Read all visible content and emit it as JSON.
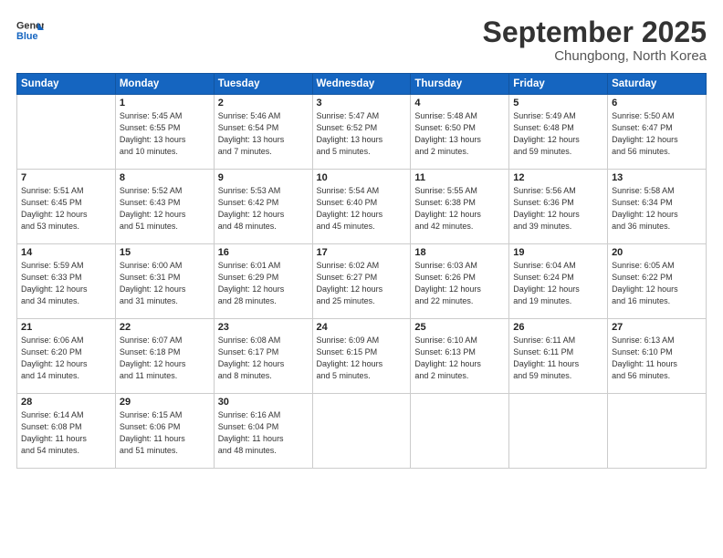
{
  "logo": {
    "line1": "General",
    "line2": "Blue"
  },
  "header": {
    "month": "September 2025",
    "location": "Chungbong, North Korea"
  },
  "weekdays": [
    "Sunday",
    "Monday",
    "Tuesday",
    "Wednesday",
    "Thursday",
    "Friday",
    "Saturday"
  ],
  "weeks": [
    [
      {
        "day": "",
        "info": ""
      },
      {
        "day": "1",
        "info": "Sunrise: 5:45 AM\nSunset: 6:55 PM\nDaylight: 13 hours\nand 10 minutes."
      },
      {
        "day": "2",
        "info": "Sunrise: 5:46 AM\nSunset: 6:54 PM\nDaylight: 13 hours\nand 7 minutes."
      },
      {
        "day": "3",
        "info": "Sunrise: 5:47 AM\nSunset: 6:52 PM\nDaylight: 13 hours\nand 5 minutes."
      },
      {
        "day": "4",
        "info": "Sunrise: 5:48 AM\nSunset: 6:50 PM\nDaylight: 13 hours\nand 2 minutes."
      },
      {
        "day": "5",
        "info": "Sunrise: 5:49 AM\nSunset: 6:48 PM\nDaylight: 12 hours\nand 59 minutes."
      },
      {
        "day": "6",
        "info": "Sunrise: 5:50 AM\nSunset: 6:47 PM\nDaylight: 12 hours\nand 56 minutes."
      }
    ],
    [
      {
        "day": "7",
        "info": "Sunrise: 5:51 AM\nSunset: 6:45 PM\nDaylight: 12 hours\nand 53 minutes."
      },
      {
        "day": "8",
        "info": "Sunrise: 5:52 AM\nSunset: 6:43 PM\nDaylight: 12 hours\nand 51 minutes."
      },
      {
        "day": "9",
        "info": "Sunrise: 5:53 AM\nSunset: 6:42 PM\nDaylight: 12 hours\nand 48 minutes."
      },
      {
        "day": "10",
        "info": "Sunrise: 5:54 AM\nSunset: 6:40 PM\nDaylight: 12 hours\nand 45 minutes."
      },
      {
        "day": "11",
        "info": "Sunrise: 5:55 AM\nSunset: 6:38 PM\nDaylight: 12 hours\nand 42 minutes."
      },
      {
        "day": "12",
        "info": "Sunrise: 5:56 AM\nSunset: 6:36 PM\nDaylight: 12 hours\nand 39 minutes."
      },
      {
        "day": "13",
        "info": "Sunrise: 5:58 AM\nSunset: 6:34 PM\nDaylight: 12 hours\nand 36 minutes."
      }
    ],
    [
      {
        "day": "14",
        "info": "Sunrise: 5:59 AM\nSunset: 6:33 PM\nDaylight: 12 hours\nand 34 minutes."
      },
      {
        "day": "15",
        "info": "Sunrise: 6:00 AM\nSunset: 6:31 PM\nDaylight: 12 hours\nand 31 minutes."
      },
      {
        "day": "16",
        "info": "Sunrise: 6:01 AM\nSunset: 6:29 PM\nDaylight: 12 hours\nand 28 minutes."
      },
      {
        "day": "17",
        "info": "Sunrise: 6:02 AM\nSunset: 6:27 PM\nDaylight: 12 hours\nand 25 minutes."
      },
      {
        "day": "18",
        "info": "Sunrise: 6:03 AM\nSunset: 6:26 PM\nDaylight: 12 hours\nand 22 minutes."
      },
      {
        "day": "19",
        "info": "Sunrise: 6:04 AM\nSunset: 6:24 PM\nDaylight: 12 hours\nand 19 minutes."
      },
      {
        "day": "20",
        "info": "Sunrise: 6:05 AM\nSunset: 6:22 PM\nDaylight: 12 hours\nand 16 minutes."
      }
    ],
    [
      {
        "day": "21",
        "info": "Sunrise: 6:06 AM\nSunset: 6:20 PM\nDaylight: 12 hours\nand 14 minutes."
      },
      {
        "day": "22",
        "info": "Sunrise: 6:07 AM\nSunset: 6:18 PM\nDaylight: 12 hours\nand 11 minutes."
      },
      {
        "day": "23",
        "info": "Sunrise: 6:08 AM\nSunset: 6:17 PM\nDaylight: 12 hours\nand 8 minutes."
      },
      {
        "day": "24",
        "info": "Sunrise: 6:09 AM\nSunset: 6:15 PM\nDaylight: 12 hours\nand 5 minutes."
      },
      {
        "day": "25",
        "info": "Sunrise: 6:10 AM\nSunset: 6:13 PM\nDaylight: 12 hours\nand 2 minutes."
      },
      {
        "day": "26",
        "info": "Sunrise: 6:11 AM\nSunset: 6:11 PM\nDaylight: 11 hours\nand 59 minutes."
      },
      {
        "day": "27",
        "info": "Sunrise: 6:13 AM\nSunset: 6:10 PM\nDaylight: 11 hours\nand 56 minutes."
      }
    ],
    [
      {
        "day": "28",
        "info": "Sunrise: 6:14 AM\nSunset: 6:08 PM\nDaylight: 11 hours\nand 54 minutes."
      },
      {
        "day": "29",
        "info": "Sunrise: 6:15 AM\nSunset: 6:06 PM\nDaylight: 11 hours\nand 51 minutes."
      },
      {
        "day": "30",
        "info": "Sunrise: 6:16 AM\nSunset: 6:04 PM\nDaylight: 11 hours\nand 48 minutes."
      },
      {
        "day": "",
        "info": ""
      },
      {
        "day": "",
        "info": ""
      },
      {
        "day": "",
        "info": ""
      },
      {
        "day": "",
        "info": ""
      }
    ]
  ]
}
